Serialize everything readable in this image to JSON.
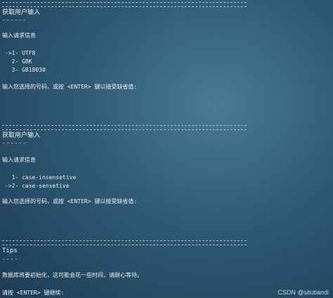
{
  "section1": {
    "title": "获取用户输入",
    "underline": "------",
    "prompt": "输入请求信息",
    "options": [
      "->1- UTF8",
      "  2- GBK",
      "  3- GB18030"
    ],
    "input_prompt": "输入您选择的号码，或按 <ENTER> 键以接受缺省值:"
  },
  "section2": {
    "title": "获取用户输入",
    "underline": "------",
    "prompt": "输入请求信息",
    "options": [
      "  1- case-insensetive",
      "->2- case-sensetive"
    ],
    "input_prompt": "输入您选择的号码，或按 <ENTER> 键以接受缺省值:"
  },
  "section3": {
    "title": "Tips",
    "underline": "----",
    "message": "数据库将要初始化，这可能会花一些时间，请耐心等待。",
    "continue_prompt": "请按 <ENTER> 键继续:"
  },
  "watermark": "CSDN @situtiandi"
}
